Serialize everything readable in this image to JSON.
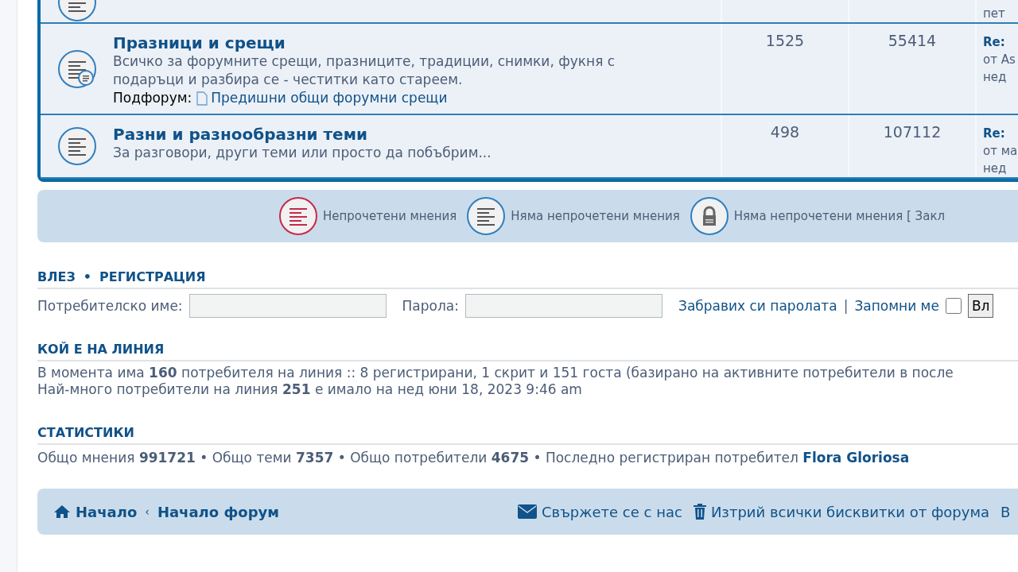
{
  "forums": [
    {
      "kind": "read",
      "last_post": [
        "пет"
      ]
    },
    {
      "kind": "read_sub",
      "title": "Празници и срещи",
      "description": "Всичко за форумните срещи, празниците, традиции, снимки, фукня с подаръци и разбира се - честитки като стареем.",
      "subforum_label": "Подфорум:",
      "subforums": [
        "Предишни общи форумни срещи"
      ],
      "topics": "1525",
      "posts": "55414",
      "last_post": [
        "Re:",
        "от As",
        "нед"
      ]
    },
    {
      "kind": "read",
      "title": "Разни и разнообразни теми",
      "description": "За разговори, други теми или просто да побъбрим...",
      "topics": "498",
      "posts": "107112",
      "last_post": [
        "Re:",
        "от ма",
        "нед"
      ]
    }
  ],
  "legend": [
    {
      "kind": "unread",
      "label": "Непрочетени мнения"
    },
    {
      "kind": "read",
      "label": "Няма непрочетени мнения"
    },
    {
      "kind": "locked",
      "label": "Няма непрочетени мнения [ Закл"
    }
  ],
  "login": {
    "links": [
      "ВЛЕЗ",
      "РЕГИСТРАЦИЯ"
    ],
    "link_separator": "•",
    "username_label": "Потребителско име:",
    "password_label": "Парола:",
    "forgot_link": "Забравих си паролата",
    "separator": "|",
    "remember_label": "Запомни ме",
    "remember_checked": false,
    "submit": "Вл"
  },
  "online": {
    "title": "КОЙ Е НА ЛИНИЯ",
    "lines": [
      "В момента има **160** потребителя на линия :: 8 регистрирани, 1 скрит и 151 госта (базирано на активните потребители в после",
      "Най-много потребители на линия **251** е имало на нед юни 18, 2023 9:46 am"
    ]
  },
  "statistics": {
    "title": "СТАТИСТИКИ",
    "text": "Общо мнения **991721** • Общо теми **7357** • Общо потребители **4675** • Последно регистриран потребител",
    "newest_user": "Flora Gloriosa"
  },
  "footer": {
    "breadcrumbs": [
      "Начало",
      "Начало форум"
    ],
    "breadcrumb_separator": "‹",
    "links": [
      {
        "kind": "envelope",
        "label": "Свържете се с нас"
      },
      {
        "kind": "trash",
        "label": "Изтрий всички бисквитки от форума"
      },
      {
        "kind": "plain",
        "label": "В"
      }
    ]
  }
}
